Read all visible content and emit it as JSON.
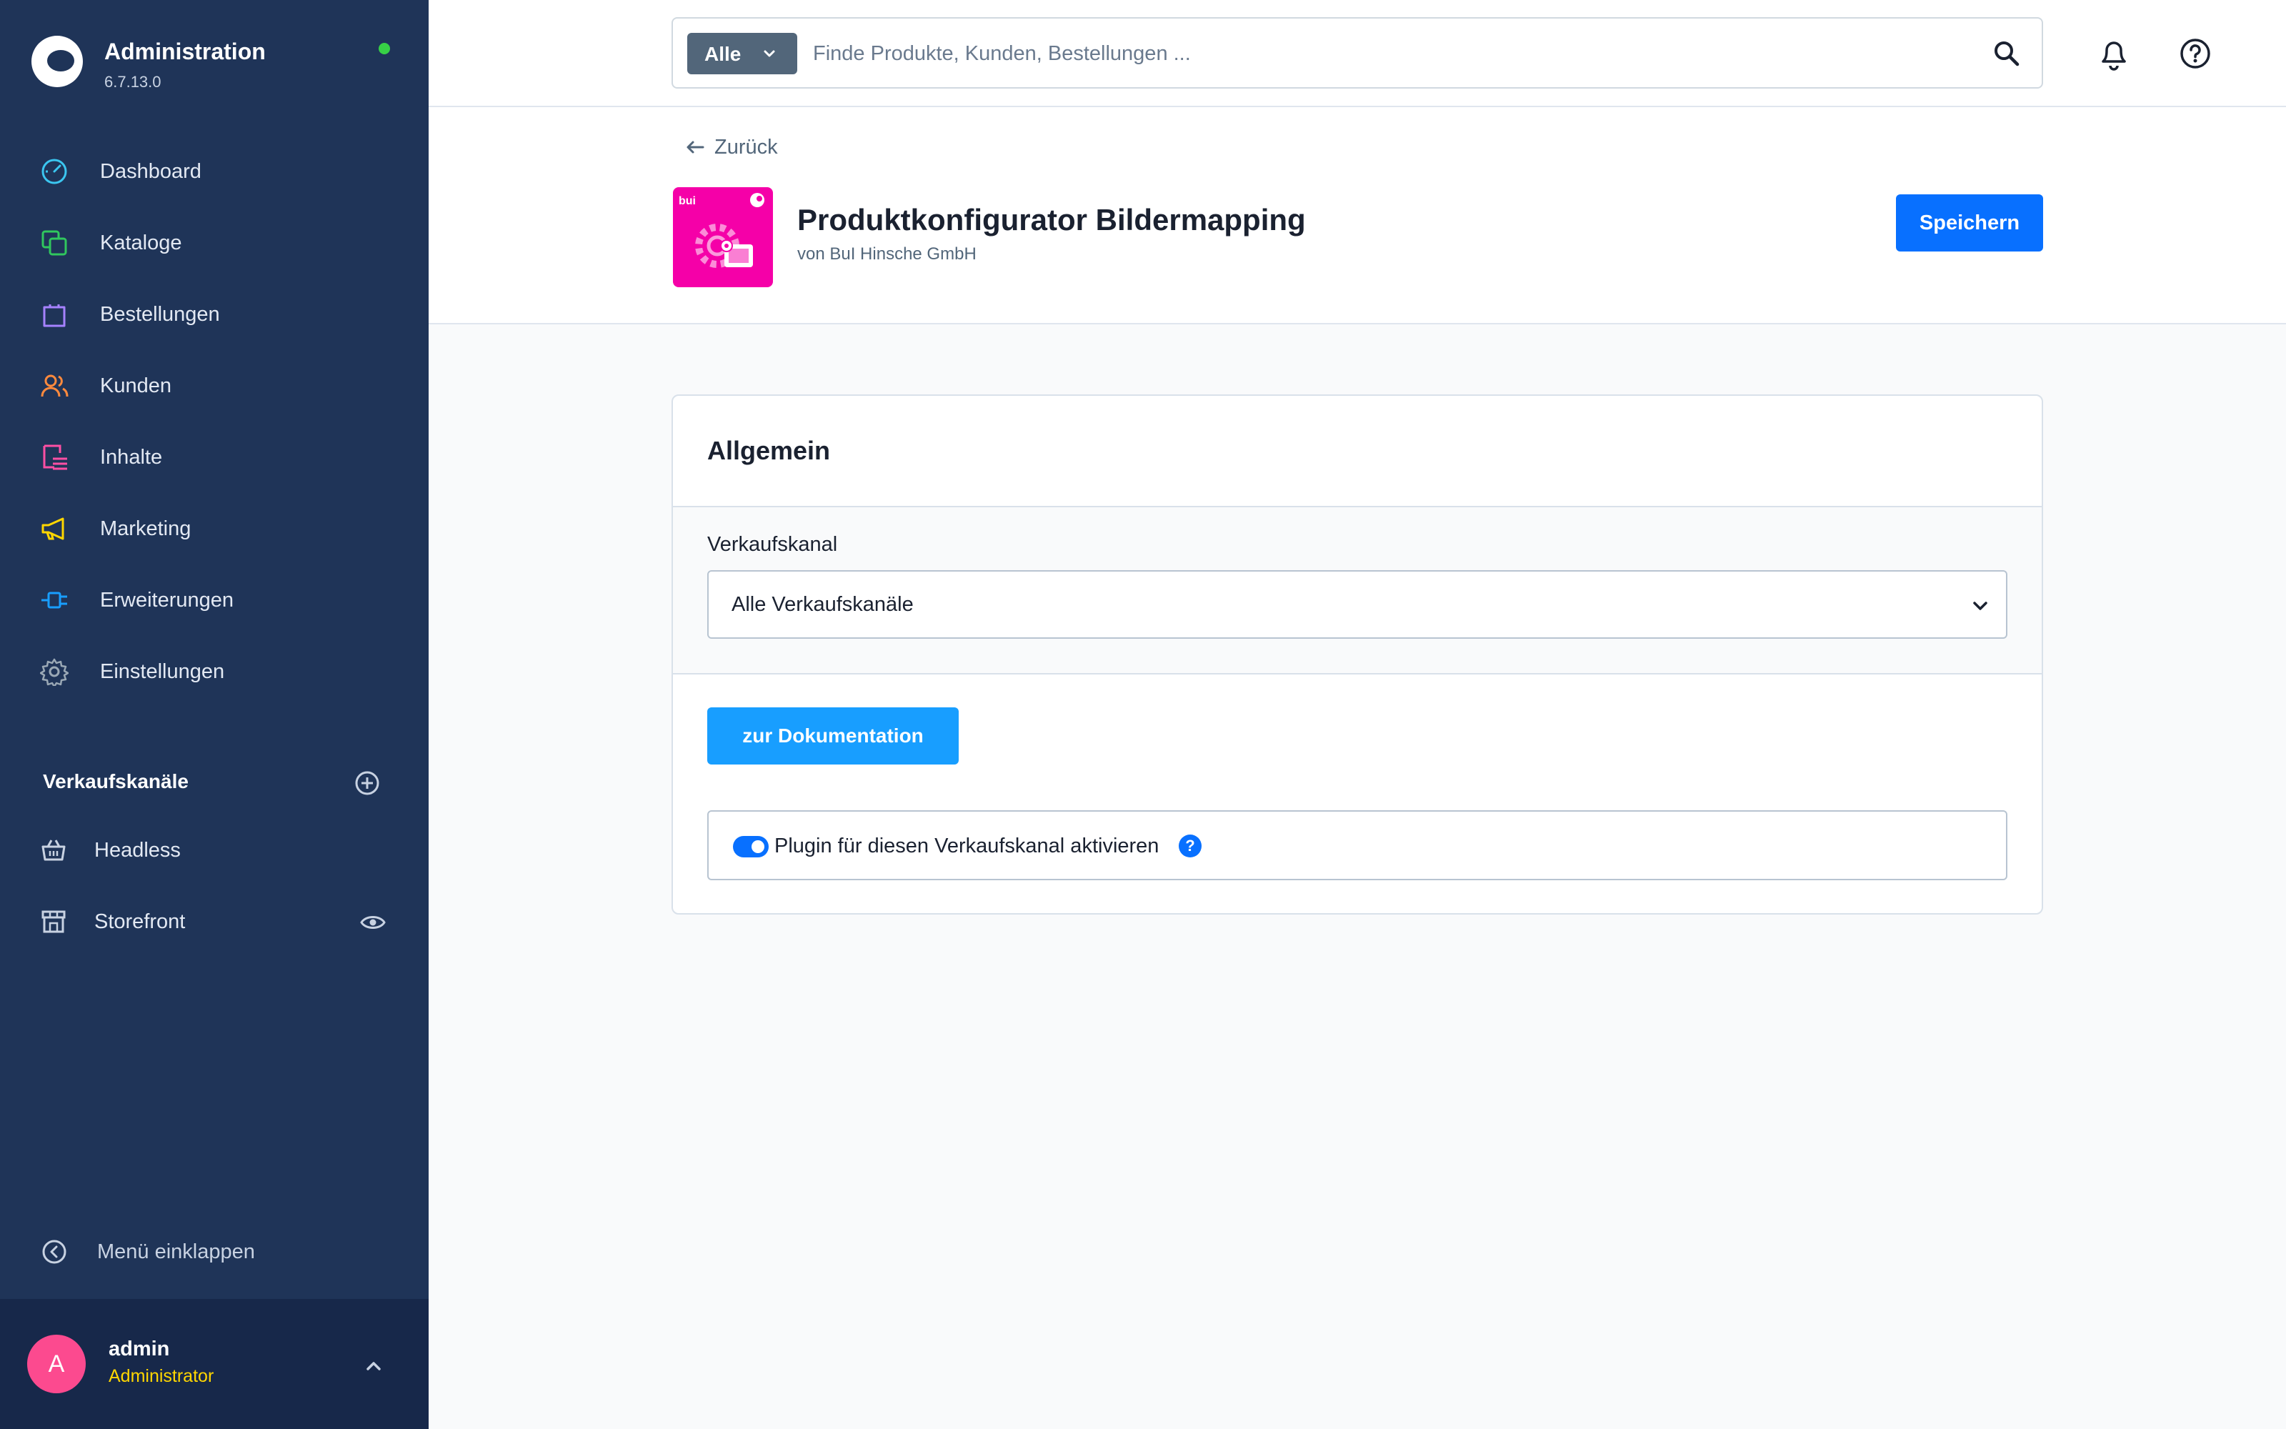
{
  "brand": {
    "title": "Administration",
    "version": "6.7.13.0"
  },
  "sidebar": {
    "items": [
      {
        "label": "Dashboard",
        "icon": "gauge-icon",
        "color": "#3bc6f0"
      },
      {
        "label": "Kataloge",
        "icon": "catalog-icon",
        "color": "#30c75e"
      },
      {
        "label": "Bestellungen",
        "icon": "shopping-bag-icon",
        "color": "#a682ff"
      },
      {
        "label": "Kunden",
        "icon": "users-icon",
        "color": "#ff8a3d"
      },
      {
        "label": "Inhalte",
        "icon": "content-icon",
        "color": "#ff4fa4"
      },
      {
        "label": "Marketing",
        "icon": "megaphone-icon",
        "color": "#ffd600"
      },
      {
        "label": "Erweiterungen",
        "icon": "plugin-icon",
        "color": "#189eff"
      },
      {
        "label": "Einstellungen",
        "icon": "gear-icon",
        "color": "#9aa8b5"
      }
    ],
    "sales_channels_title": "Verkaufskanäle",
    "sales_channels": [
      {
        "label": "Headless",
        "icon": "basket-icon"
      },
      {
        "label": "Storefront",
        "icon": "storefront-icon"
      }
    ],
    "collapse_label": "Menü einklappen"
  },
  "user": {
    "initial": "A",
    "name": "admin",
    "role": "Administrator"
  },
  "search": {
    "type_label": "Alle",
    "placeholder": "Finde Produkte, Kunden, Bestellungen ..."
  },
  "header": {
    "back_label": "Zurück",
    "plugin_name": "Produktkonfigurator Bildermapping",
    "plugin_vendor": "von BuI Hinsche GmbH",
    "plugin_logo_text": "bui",
    "save_label": "Speichern"
  },
  "card": {
    "title": "Allgemein",
    "field_label": "Verkaufskanal",
    "select_value": "Alle Verkaufskanäle",
    "doc_button": "zur Dokumentation",
    "toggle_label": "Plugin für diesen Verkaufskanal aktivieren",
    "toggle_on": true,
    "help_glyph": "?"
  },
  "colors": {
    "sidebar": "#1f3458",
    "primary": "#0870ff",
    "doc_button": "#189eff",
    "plugin_bg": "#f500a8"
  }
}
